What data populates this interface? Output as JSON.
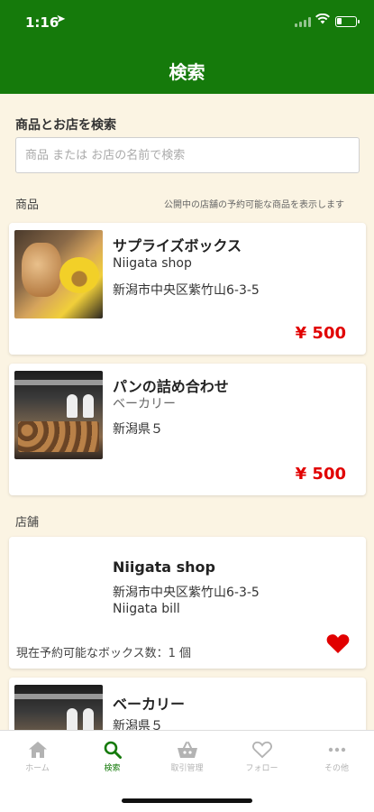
{
  "status_bar": {
    "time": "1:16",
    "location_icon": "location-arrow-icon"
  },
  "header": {
    "title": "検索"
  },
  "search": {
    "heading": "商品とお店を検索",
    "placeholder": "商品 または お店の名前で検索",
    "value": ""
  },
  "products_section": {
    "title": "商品",
    "note": "公開中の店舗の予約可能な商品を表示します",
    "items": [
      {
        "name": "サプライズボックス",
        "shop": "Niigata shop",
        "address": "新潟市中央区紫竹山6-3-5",
        "price": "¥ 500"
      },
      {
        "name": "パンの詰め合わせ",
        "shop": "ベーカリー",
        "address": "新潟県５",
        "price": "¥ 500"
      }
    ]
  },
  "shops_section": {
    "title": "店舗",
    "items": [
      {
        "name": "Niigata shop",
        "address": "新潟市中央区紫竹山6-3-5",
        "building": "Niigata bill",
        "available": "現在予約可能なボックス数：1 個",
        "favorite": true
      },
      {
        "name": "ベーカリー",
        "address": "新潟県５"
      }
    ]
  },
  "tabbar": {
    "items": [
      {
        "label": "ホーム",
        "icon": "home-icon",
        "active": false
      },
      {
        "label": "検索",
        "icon": "search-icon",
        "active": true
      },
      {
        "label": "取引管理",
        "icon": "basket-icon",
        "active": false
      },
      {
        "label": "フォロー",
        "icon": "heart-icon",
        "active": false
      },
      {
        "label": "その他",
        "icon": "more-icon",
        "active": false
      }
    ]
  },
  "colors": {
    "brand_green": "#157a0b",
    "price_red": "#e10000",
    "background": "#fbf4e3"
  }
}
